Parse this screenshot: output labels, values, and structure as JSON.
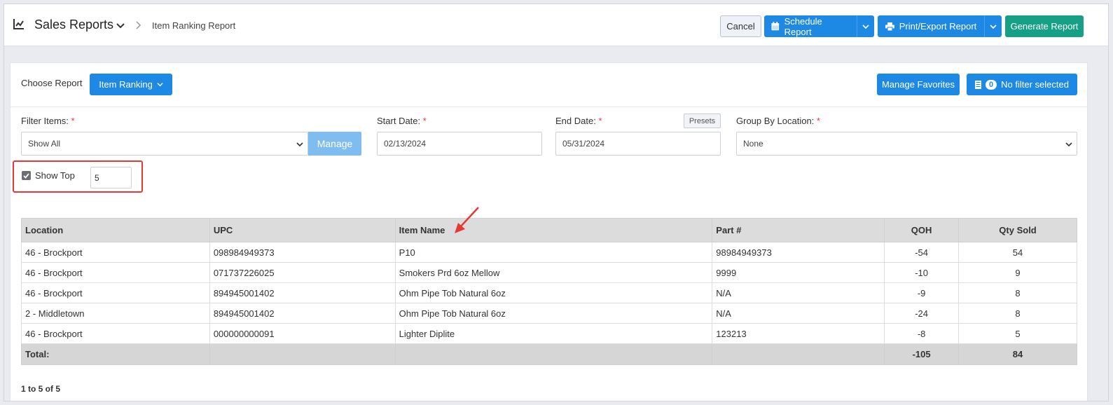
{
  "header": {
    "title": "Sales Reports",
    "breadcrumb": "Item Ranking Report",
    "cancel_label": "Cancel",
    "schedule_label": "Schedule Report",
    "print_label": "Print/Export Report",
    "generate_label": "Generate Report"
  },
  "choose": {
    "label": "Choose Report",
    "report_label": "Item Ranking",
    "favorites_label": "Manage Favorites",
    "filter_count": "0",
    "filter_label": "No filter selected"
  },
  "filters": {
    "filter_items_label": "Filter Items:",
    "filter_items_value": "Show All",
    "manage_label": "Manage",
    "start_label": "Start Date:",
    "start_value": "02/13/2024",
    "end_label": "End Date:",
    "end_value": "05/31/2024",
    "presets_label": "Presets",
    "group_label": "Group By Location:",
    "group_value": "None",
    "required_mark": "*",
    "show_top_label": "Show Top",
    "show_top_value": "5",
    "show_top_checked": true
  },
  "table": {
    "columns": [
      "Location",
      "UPC",
      "Item Name",
      "Part #",
      "QOH",
      "Qty Sold"
    ],
    "rows": [
      [
        "46 - Brockport",
        "098984949373",
        "P10",
        "98984949373",
        "-54",
        "54"
      ],
      [
        "46 - Brockport",
        "071737226025",
        "Smokers Prd 6oz Mellow",
        "9999",
        "-10",
        "9"
      ],
      [
        "46 - Brockport",
        "894945001402",
        "Ohm Pipe Tob Natural 6oz",
        "N/A",
        "-9",
        "8"
      ],
      [
        "2 - Middletown",
        "894945001402",
        "Ohm Pipe Tob Natural 6oz",
        "N/A",
        "-24",
        "8"
      ],
      [
        "46 - Brockport",
        "000000000091",
        "Lighter Diplite",
        "123213",
        "-8",
        "5"
      ]
    ],
    "total_label": "Total:",
    "total_qoh": "-105",
    "total_qty": "84"
  },
  "pager": "1 to 5 of 5",
  "colors": {
    "primary": "#1e88e5",
    "success": "#16a085",
    "highlight": "#e53935"
  }
}
